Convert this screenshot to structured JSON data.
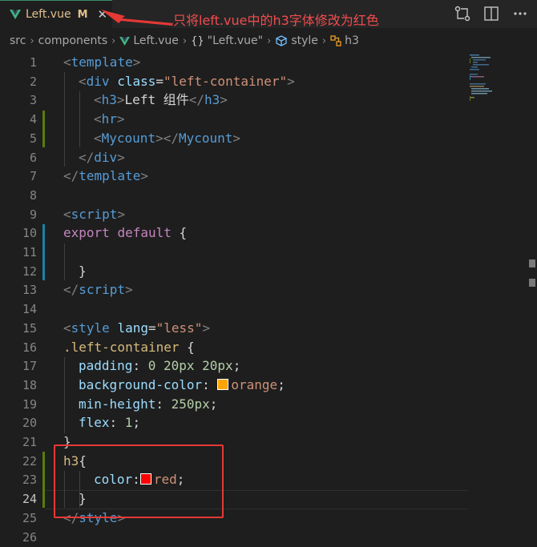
{
  "tab": {
    "title": "Left.vue",
    "modified": "M",
    "close": "✕"
  },
  "annotation": {
    "text": "只将left.vue中的h3字体修改为红色"
  },
  "breadcrumb": {
    "items": [
      "src",
      "components",
      "Left.vue",
      "\"Left.vue\"",
      "style",
      "h3"
    ],
    "braces": "{}"
  },
  "colors": {
    "orange_swatch": "#ffa500",
    "red_swatch": "#ff0000",
    "annotation": "#f14c4c"
  },
  "line_numbers": [
    "1",
    "2",
    "3",
    "4",
    "5",
    "6",
    "7",
    "8",
    "9",
    "10",
    "11",
    "12",
    "13",
    "14",
    "15",
    "16",
    "17",
    "18",
    "19",
    "20",
    "21",
    "22",
    "23",
    "24",
    "25",
    "26"
  ],
  "code": {
    "l1": [
      "<",
      "template",
      ">"
    ],
    "l2": [
      "<",
      "div",
      " ",
      "class",
      "=",
      "\"left-container\"",
      ">"
    ],
    "l3": [
      "<",
      "h3",
      ">",
      "Left 组件",
      "</",
      "h3",
      ">"
    ],
    "l4": [
      "<",
      "hr",
      ">"
    ],
    "l5": [
      "<",
      "Mycount",
      "></",
      "Mycount",
      ">"
    ],
    "l6": [
      "</",
      "div",
      ">"
    ],
    "l7": [
      "</",
      "template",
      ">"
    ],
    "l9": [
      "<",
      "script",
      ">"
    ],
    "l10": [
      "export",
      " ",
      "default",
      " {"
    ],
    "l12": [
      "}"
    ],
    "l13": [
      "</",
      "script",
      ">"
    ],
    "l15": [
      "<",
      "style",
      " ",
      "lang",
      "=",
      "\"less\"",
      ">"
    ],
    "l16": [
      ".left-container",
      " {"
    ],
    "l17": [
      "padding",
      ": ",
      "0",
      " ",
      "20px",
      " ",
      "20px",
      ";"
    ],
    "l18": [
      "background-color",
      ": ",
      "orange",
      ";"
    ],
    "l19": [
      "min-height",
      ": ",
      "250px",
      ";"
    ],
    "l20": [
      "flex",
      ": ",
      "1",
      ";"
    ],
    "l21": [
      "}"
    ],
    "l22": [
      "h3",
      "{"
    ],
    "l23": [
      "color",
      ":",
      "red",
      ";"
    ],
    "l24": [
      "}"
    ],
    "l25": [
      "</",
      "style",
      ">"
    ]
  }
}
